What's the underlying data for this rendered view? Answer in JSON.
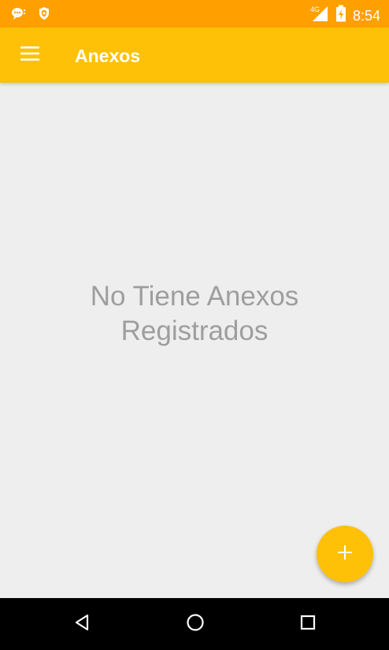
{
  "status_bar": {
    "time": "8:54",
    "network": "4G",
    "icons": [
      "chat-notification-icon",
      "shield-icon",
      "signal-4g-icon",
      "battery-charging-icon"
    ],
    "color": "#ffa000"
  },
  "app_bar": {
    "title": "Anexos",
    "menu_icon": "hamburger-menu-icon",
    "color": "#ffc107"
  },
  "content": {
    "empty_line1": "No Tiene Anexos",
    "empty_line2": "Registrados"
  },
  "fab": {
    "icon": "plus-icon",
    "color": "#ffc107"
  },
  "nav_bar": {
    "buttons": [
      "back-icon",
      "home-icon",
      "recents-icon"
    ]
  }
}
